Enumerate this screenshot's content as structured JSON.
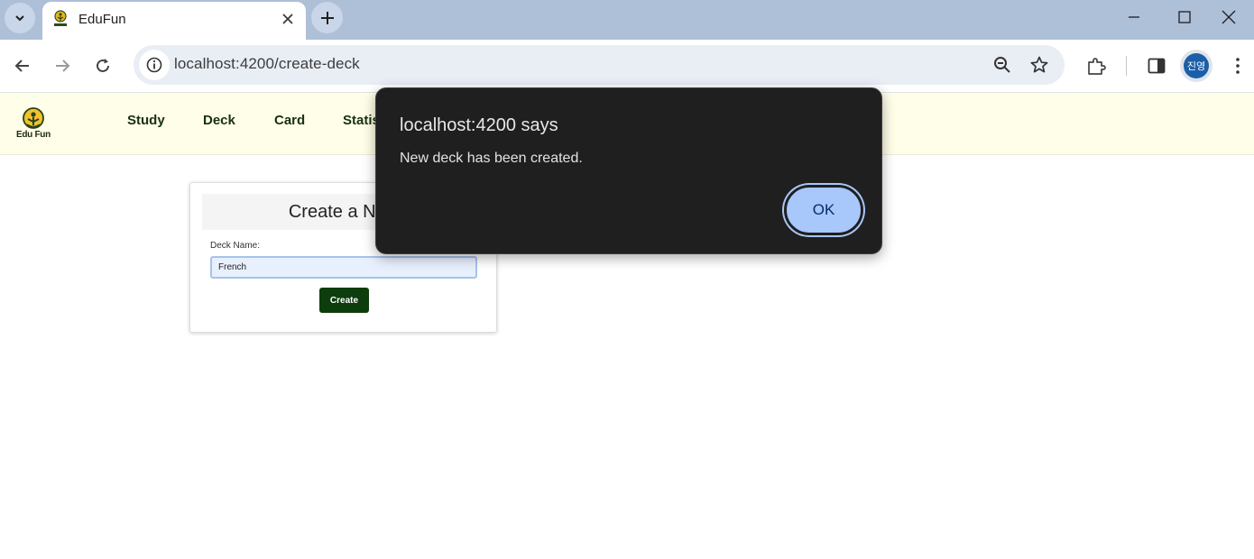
{
  "browser": {
    "tab": {
      "title": "EduFun"
    },
    "omnibox": {
      "url": "localhost:4200/create-deck"
    },
    "profile": {
      "initials": "진영"
    }
  },
  "app": {
    "logo_text": "Edu Fun",
    "nav": [
      {
        "label": "Study"
      },
      {
        "label": "Deck"
      },
      {
        "label": "Card"
      },
      {
        "label": "Statis"
      }
    ]
  },
  "form": {
    "title": "Create a New",
    "deck_label": "Deck Name:",
    "deck_value": "French",
    "create_label": "Create"
  },
  "dialog": {
    "title": "localhost:4200 says",
    "message": "New deck has been created.",
    "ok_label": "OK"
  },
  "colors": {
    "tabstrip": "#aebfd8",
    "header_bg": "#fffee8",
    "create_button": "#0d3d0d",
    "dialog_bg": "#1f1f1f",
    "ok_button": "#a8c7fa"
  }
}
